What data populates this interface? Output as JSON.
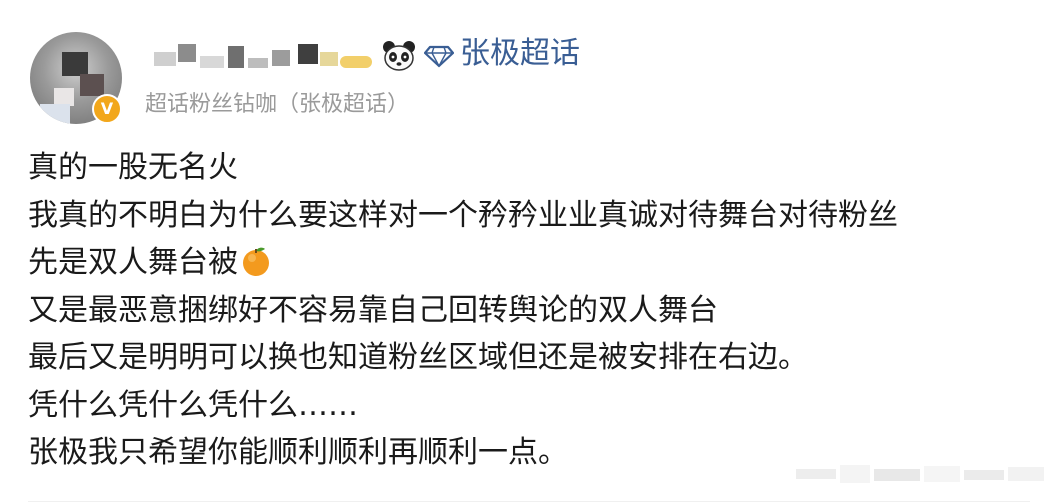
{
  "post": {
    "supertopic_name": "张极超话",
    "subtitle": "超话粉丝钻咖（张极超话）",
    "lines": [
      "真的一股无名火",
      "我真的不明白为什么要这样对一个矜矜业业真诚对待舞台对待粉丝",
      "先是双人舞台被",
      "又是最恶意捆绑好不容易靠自己回转舆论的双人舞台",
      "最后又是明明可以换也知道粉丝区域但还是被安排在右边。",
      "凭什么凭什么凭什么……",
      "张极我只希望你能顺利顺利再顺利一点。"
    ]
  },
  "icons": {
    "avatar": "avatar-image",
    "verified": "verified-badge-icon",
    "panda": "panda-icon",
    "diamond": "diamond-icon",
    "emoji": "orange-emoji-icon"
  },
  "colors": {
    "link_blue": "#3a5e94",
    "gray_text": "#9a9a9a",
    "badge_orange": "#f2a71b"
  }
}
